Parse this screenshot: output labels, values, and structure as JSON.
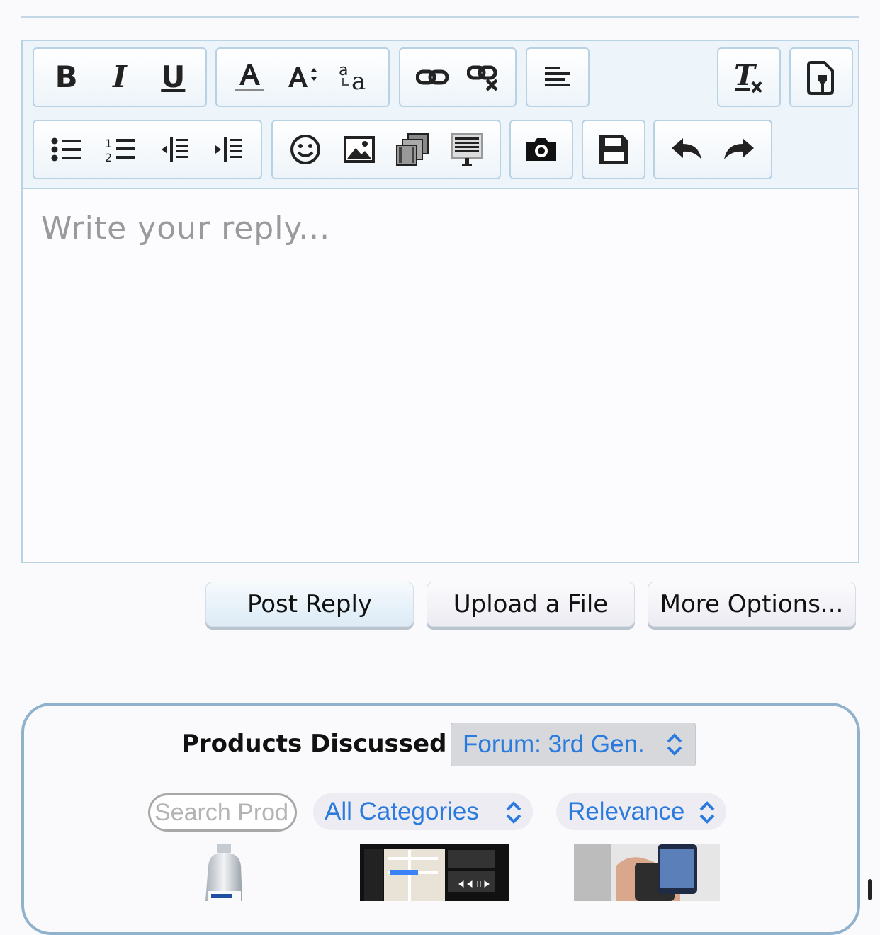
{
  "editor": {
    "toolbar_row1": [
      {
        "name": "bold-button",
        "label": "B"
      },
      {
        "name": "italic-button",
        "label": "I"
      },
      {
        "name": "underline-button",
        "label": "U"
      }
    ],
    "reply_placeholder": "Write your reply...",
    "reply_value": ""
  },
  "actions": {
    "post_reply": "Post Reply",
    "upload_file": "Upload a File",
    "more_options": "More Options..."
  },
  "products": {
    "title": "Products Discussed in",
    "forum_select_value": "Forum: 3rd Gen.",
    "search_placeholder": "Search Prod",
    "category_select_value": "All Categories",
    "sort_select_value": "Relevance",
    "thumbnails": [
      {
        "icon": "oil-jug-product-image"
      },
      {
        "icon": "carplay-head-unit-product-image"
      },
      {
        "icon": "carlink-obd-device-product-image"
      }
    ]
  },
  "colors": {
    "accent_blue": "#2b7bde",
    "border_blue": "#b7d3e4",
    "panel_border": "#91b2cc"
  }
}
